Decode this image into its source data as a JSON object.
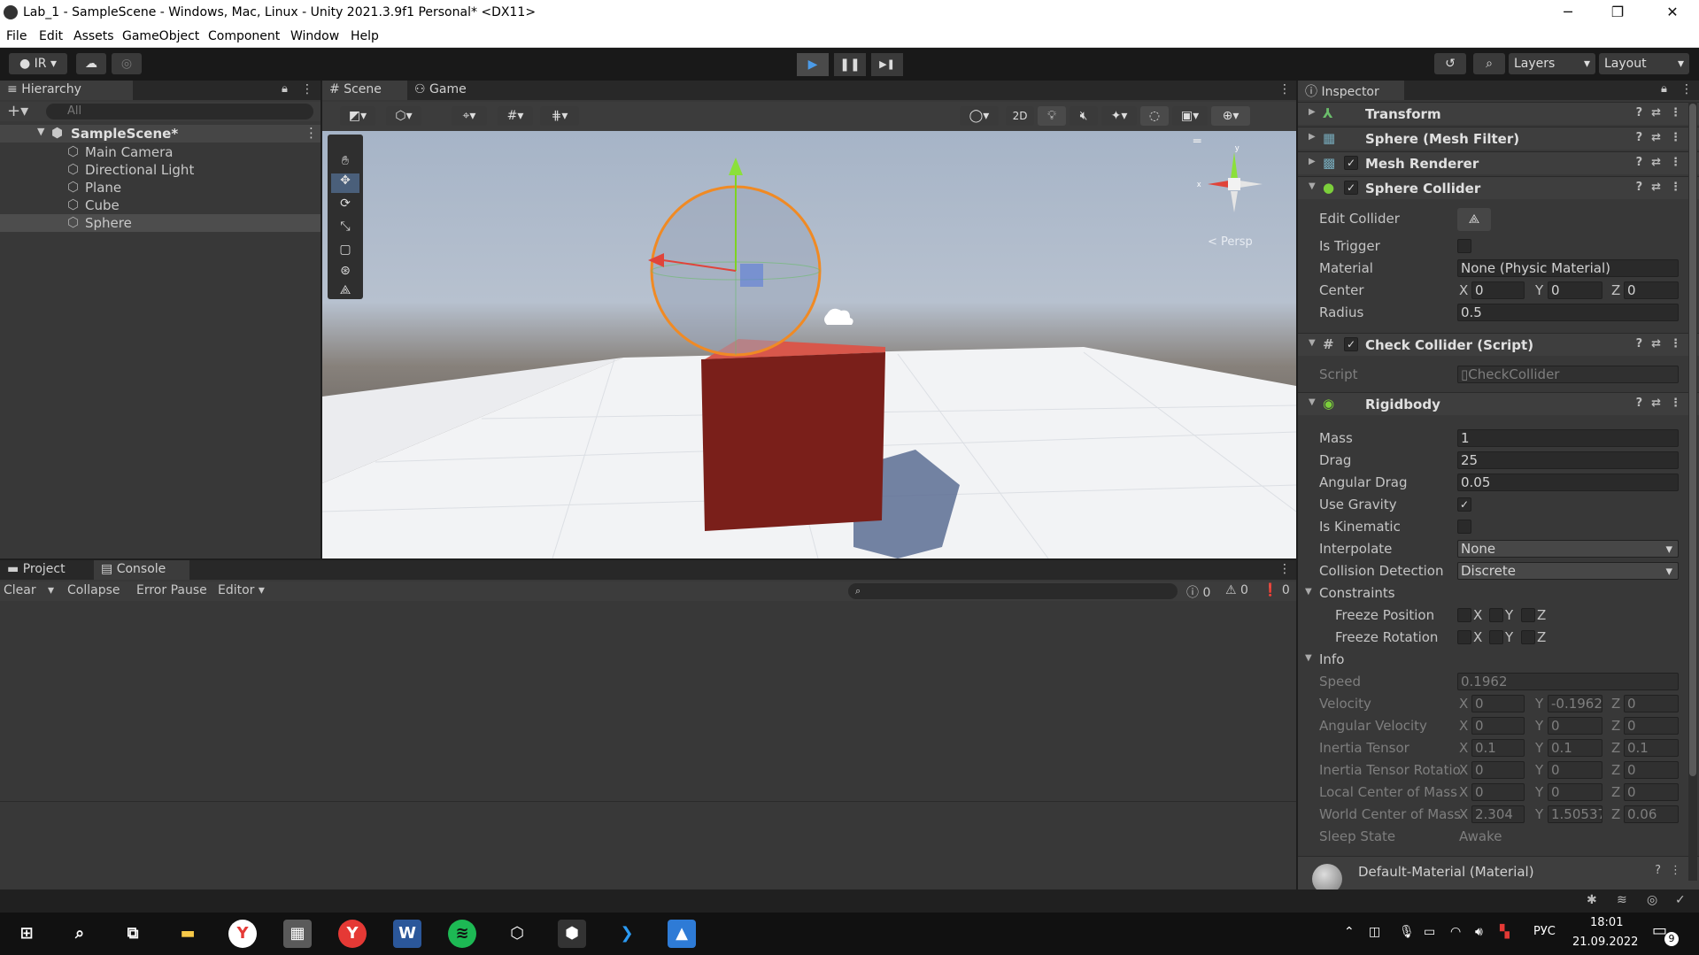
{
  "window": {
    "title": "Lab_1 - SampleScene - Windows, Mac, Linux - Unity 2021.3.9f1 Personal* <DX11>",
    "minimize": "─",
    "maximize": "❐",
    "close": "✕"
  },
  "menu": [
    "File",
    "Edit",
    "Assets",
    "GameObject",
    "Component",
    "Window",
    "Help"
  ],
  "toolbar": {
    "account": "IR",
    "layers": "Layers",
    "layout": "Layout",
    "play_icon": "▶",
    "pause_icon": "❚❚",
    "step_icon": "▶❚"
  },
  "hierarchy": {
    "tab": "Hierarchy",
    "search_placeholder": "All",
    "scene": "SampleScene*",
    "items": [
      "Main Camera",
      "Directional Light",
      "Plane",
      "Cube",
      "Sphere"
    ],
    "selected": "Sphere"
  },
  "scene_view": {
    "tabs": [
      "Scene",
      "Game"
    ],
    "mode_2d": "2D",
    "persp_label": "< Persp"
  },
  "inspector": {
    "tab": "Inspector",
    "components": {
      "transform": "Transform",
      "mesh_filter": "Sphere (Mesh Filter)",
      "mesh_renderer": "Mesh Renderer",
      "sphere_collider": "Sphere Collider",
      "check_collider": "Check Collider (Script)",
      "rigidbody": "Rigidbody"
    },
    "sphere_collider": {
      "edit_collider_label": "Edit Collider",
      "is_trigger_label": "Is Trigger",
      "material_label": "Material",
      "material_value": "None (Physic Material)",
      "center_label": "Center",
      "center_x": "0",
      "center_y": "0",
      "center_z": "0",
      "radius_label": "Radius",
      "radius_value": "0.5"
    },
    "script": {
      "label": "Script",
      "value": "CheckCollider"
    },
    "rigidbody": {
      "mass_label": "Mass",
      "mass": "1",
      "drag_label": "Drag",
      "drag": "25",
      "angular_drag_label": "Angular Drag",
      "angular_drag": "0.05",
      "use_gravity_label": "Use Gravity",
      "use_gravity": true,
      "is_kinematic_label": "Is Kinematic",
      "is_kinematic": false,
      "interpolate_label": "Interpolate",
      "interpolate": "None",
      "collision_label": "Collision Detection",
      "collision": "Discrete",
      "constraints_label": "Constraints",
      "freeze_pos_label": "Freeze Position",
      "freeze_rot_label": "Freeze Rotation",
      "info_label": "Info"
    },
    "info": {
      "speed_label": "Speed",
      "speed": "0.1962",
      "velocity_label": "Velocity",
      "velocity": [
        "0",
        "-0.1962",
        "0"
      ],
      "ang_vel_label": "Angular Velocity",
      "ang_vel": [
        "0",
        "0",
        "0"
      ],
      "inertia_label": "Inertia Tensor",
      "inertia": [
        "0.1",
        "0.1",
        "0.1"
      ],
      "inertia_rot_label": "Inertia Tensor Rotatio",
      "inertia_rot": [
        "0",
        "0",
        "0"
      ],
      "local_com_label": "Local Center of Mass",
      "local_com": [
        "0",
        "0",
        "0"
      ],
      "world_com_label": "World Center of Mass",
      "world_com": [
        "2.304",
        "1.50537",
        "0.06"
      ],
      "sleep_label": "Sleep State",
      "sleep": "Awake"
    },
    "material": "Default-Material (Material)"
  },
  "console": {
    "tabs": [
      "Project",
      "Console"
    ],
    "clear": "Clear",
    "collapse": "Collapse",
    "error_pause": "Error Pause",
    "editor": "Editor",
    "counts": [
      "0",
      "0",
      "0"
    ]
  },
  "taskbar": {
    "lang": "РУС",
    "time": "18:01",
    "date": "21.09.2022",
    "notifications": "9"
  },
  "colors": {
    "accent": "#4b9be8",
    "cube": "#7a1f1a",
    "sphere_outline": "#f08a24"
  }
}
